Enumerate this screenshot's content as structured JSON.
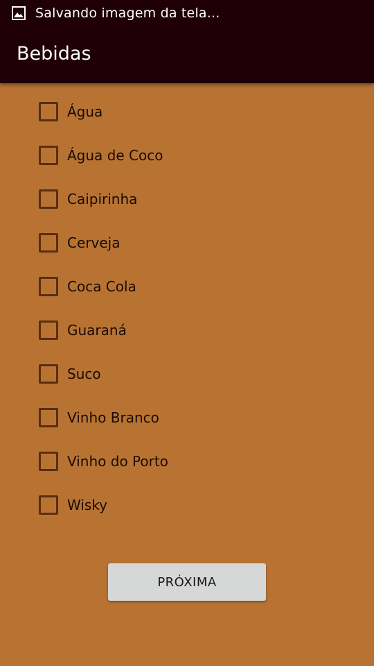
{
  "status_bar": {
    "icon": "image-icon",
    "text": "Salvando imagem da tela..."
  },
  "app_bar": {
    "title": "Bebidas"
  },
  "drinks": [
    {
      "label": "Água",
      "checked": false
    },
    {
      "label": "Água de Coco",
      "checked": false
    },
    {
      "label": "Caipirinha",
      "checked": false
    },
    {
      "label": "Cerveja",
      "checked": false
    },
    {
      "label": "Coca Cola",
      "checked": false
    },
    {
      "label": "Guaraná",
      "checked": false
    },
    {
      "label": "Suco",
      "checked": false
    },
    {
      "label": "Vinho Branco",
      "checked": false
    },
    {
      "label": "Vinho do Porto",
      "checked": false
    },
    {
      "label": "Wisky",
      "checked": false
    }
  ],
  "next_button": {
    "label": "PRÓXIMA"
  },
  "colors": {
    "background": "#b87333",
    "app_bar": "#1f0006",
    "checkbox_border": "#5a2e0e",
    "button": "#d6d7d7"
  }
}
